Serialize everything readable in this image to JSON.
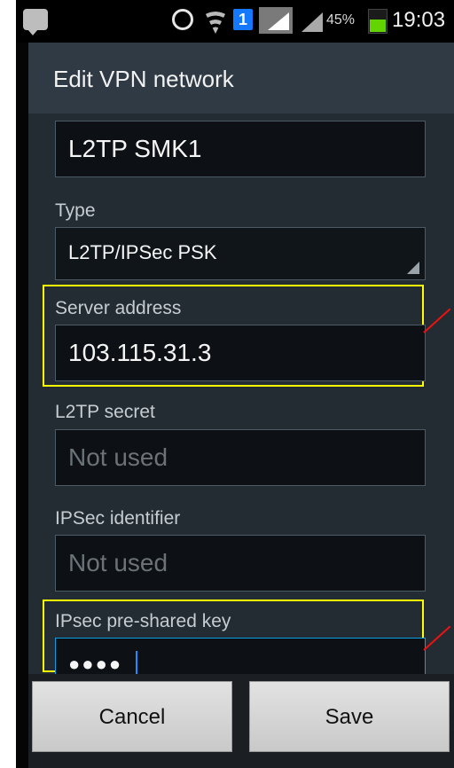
{
  "status_bar": {
    "battery_percent_text": "45%",
    "time": "19:03",
    "network_badge_text": "1"
  },
  "dialog": {
    "title": "Edit VPN network",
    "name_field": {
      "value": "L2TP SMK1"
    },
    "type": {
      "label": "Type",
      "value": "L2TP/IPSec PSK"
    },
    "server_address": {
      "label": "Server address",
      "value": "103.115.31.3"
    },
    "l2tp_secret": {
      "label": "L2TP secret",
      "placeholder": "Not used"
    },
    "ipsec_identifier": {
      "label": "IPSec identifier",
      "placeholder": "Not used"
    },
    "ipsec_psk": {
      "label": "IPsec pre-shared key",
      "masked_value": "●●●●"
    },
    "buttons": {
      "cancel": "Cancel",
      "save": "Save"
    }
  }
}
